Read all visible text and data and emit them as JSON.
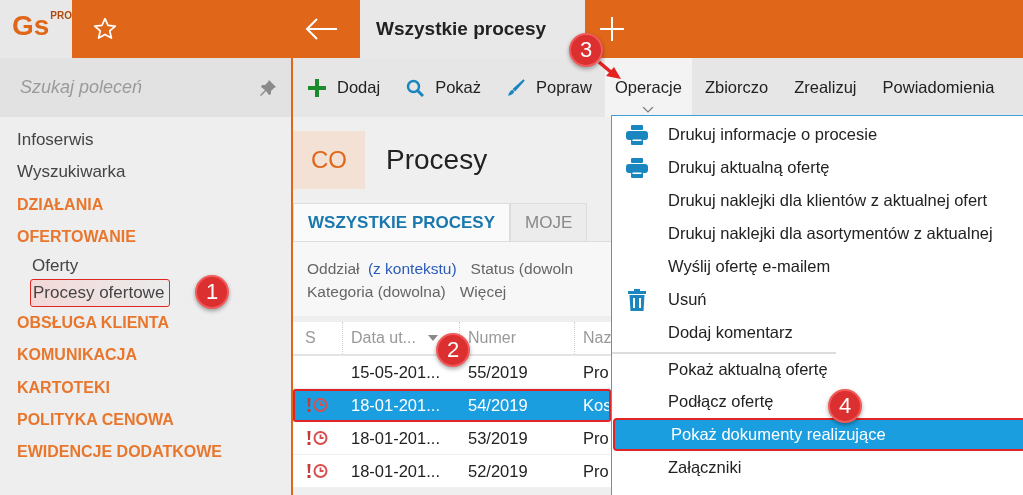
{
  "app": {
    "logo": "Gs",
    "logo_badge": "PRO"
  },
  "tabs": [
    {
      "label": "Wszystkie procesy",
      "selected": true
    }
  ],
  "sidebar": {
    "search": {
      "placeholder": "Szukaj poleceń"
    },
    "items": [
      {
        "label": "Infoserwis",
        "kind": "link",
        "selected": false
      },
      {
        "label": "Wyszukiwarka",
        "kind": "link",
        "selected": false
      },
      {
        "label": "DZIAŁANIA",
        "kind": "section",
        "selected": false
      },
      {
        "label": "OFERTOWANIE",
        "kind": "section",
        "selected": false,
        "children": [
          {
            "label": "Oferty",
            "kind": "link",
            "selected": false
          },
          {
            "label": "Procesy ofertowe",
            "kind": "link",
            "selected": true
          }
        ]
      },
      {
        "label": "OBSŁUGA KLIENTA",
        "kind": "section",
        "selected": false
      },
      {
        "label": "KOMUNIKACJA",
        "kind": "section",
        "selected": false
      },
      {
        "label": "KARTOTEKI",
        "kind": "section",
        "selected": false
      },
      {
        "label": "POLITYKA CENOWA",
        "kind": "section",
        "selected": false
      },
      {
        "label": "EWIDENCJE DODATKOWE",
        "kind": "section",
        "selected": false
      }
    ]
  },
  "toolbar": [
    {
      "label": "Dodaj",
      "kind": "plus",
      "selected": false
    },
    {
      "label": "Pokaż",
      "kind": "search",
      "selected": false
    },
    {
      "label": "Popraw",
      "kind": "brush",
      "selected": false
    },
    {
      "label": "Operacje",
      "kind": "plain",
      "selected": true
    },
    {
      "label": "Zbiorczo",
      "kind": "plain",
      "selected": false
    },
    {
      "label": "Zrealizuj",
      "kind": "plain",
      "selected": false
    },
    {
      "label": "Powiadomienia",
      "kind": "plain",
      "selected": false
    }
  ],
  "header": {
    "badge": "CO",
    "title": "Procesy"
  },
  "view_tabs": [
    {
      "label": "WSZYSTKIE PROCESY",
      "selected": true
    },
    {
      "label": "MOJE",
      "selected": false
    }
  ],
  "filters": [
    [
      {
        "label": "Oddział",
        "value": "(z kontekstu)"
      },
      {
        "label": "Status (dowoln"
      }
    ],
    [
      {
        "label": "Kategoria (dowolna)"
      },
      {
        "label": "Więcej"
      }
    ]
  ],
  "table": {
    "columns": [
      "S",
      "Data ut...",
      "Numer",
      "Naz"
    ],
    "rows": [
      {
        "alert": false,
        "date": "15-05-201...",
        "number": "55/2019",
        "name": "Pro",
        "selected": false
      },
      {
        "alert": true,
        "date": "18-01-201...",
        "number": "54/2019",
        "name": "Kos",
        "selected": true
      },
      {
        "alert": true,
        "date": "18-01-201...",
        "number": "53/2019",
        "name": "Pro",
        "selected": false
      },
      {
        "alert": true,
        "date": "18-01-201...",
        "number": "52/2019",
        "name": "Pro",
        "selected": false
      }
    ]
  },
  "menu": [
    {
      "label": "Drukuj informacje o procesie",
      "kind": "printer",
      "separator_before": false,
      "selected": false
    },
    {
      "label": "Drukuj aktualną ofertę",
      "kind": "printer",
      "separator_before": false,
      "selected": false
    },
    {
      "label": "Drukuj naklejki dla klientów z aktualnej ofert",
      "kind": "plain",
      "separator_before": false,
      "selected": false
    },
    {
      "label": "Drukuj naklejki dla asortymentów z aktualnej",
      "kind": "plain",
      "separator_before": false,
      "selected": false
    },
    {
      "label": "Wyślij ofertę e-mailem",
      "kind": "plain",
      "separator_before": false,
      "selected": false
    },
    {
      "label": "Usuń",
      "kind": "trash",
      "separator_before": false,
      "selected": false
    },
    {
      "label": "Dodaj komentarz",
      "kind": "plain",
      "separator_before": false,
      "selected": false
    },
    {
      "label": "Pokaż aktualną ofertę",
      "kind": "plain",
      "separator_before": true,
      "selected": false
    },
    {
      "label": "Podłącz ofertę",
      "kind": "plain",
      "separator_before": false,
      "selected": false
    },
    {
      "label": "Pokaż dokumenty realizujące",
      "kind": "plain",
      "separator_before": false,
      "selected": true
    },
    {
      "label": "Załączniki",
      "kind": "plain",
      "separator_before": false,
      "selected": false
    }
  ],
  "annotations": [
    {
      "number": "1",
      "arrow": false
    },
    {
      "number": "2",
      "arrow": false
    },
    {
      "number": "3",
      "arrow": true
    },
    {
      "number": "4",
      "arrow": false
    }
  ]
}
